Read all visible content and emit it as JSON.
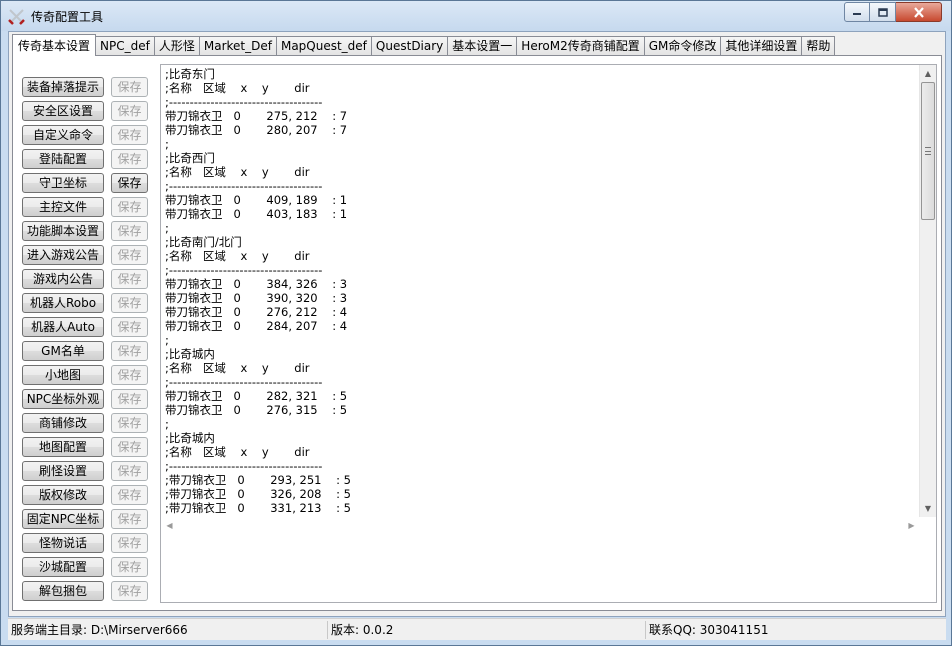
{
  "window": {
    "title": "传奇配置工具",
    "icon": "crossed-swords-icon",
    "min_icon": "minimize-icon",
    "max_icon": "maximize-icon",
    "close_icon": "close-icon"
  },
  "tabs": [
    {
      "label": "传奇基本设置",
      "active": true
    },
    {
      "label": "NPC_def"
    },
    {
      "label": "人形怪"
    },
    {
      "label": "Market_Def"
    },
    {
      "label": "MapQuest_def"
    },
    {
      "label": "QuestDiary"
    },
    {
      "label": "基本设置一"
    },
    {
      "label": "HeroM2传奇商铺配置"
    },
    {
      "label": "GM命令修改"
    },
    {
      "label": "其他详细设置"
    },
    {
      "label": "帮助"
    }
  ],
  "side_buttons": [
    {
      "label": "装备掉落提示",
      "save": "保存",
      "save_enabled": false
    },
    {
      "label": "安全区设置",
      "save": "保存",
      "save_enabled": false
    },
    {
      "label": "自定义命令",
      "save": "保存",
      "save_enabled": false
    },
    {
      "label": "登陆配置",
      "save": "保存",
      "save_enabled": false
    },
    {
      "label": "守卫坐标",
      "save": "保存",
      "save_enabled": true
    },
    {
      "label": "主控文件",
      "save": "保存",
      "save_enabled": false
    },
    {
      "label": "功能脚本设置",
      "save": "保存",
      "save_enabled": false
    },
    {
      "label": "进入游戏公告",
      "save": "保存",
      "save_enabled": false
    },
    {
      "label": "游戏内公告",
      "save": "保存",
      "save_enabled": false
    },
    {
      "label": "机器人Robo",
      "save": "保存",
      "save_enabled": false
    },
    {
      "label": "机器人Auto",
      "save": "保存",
      "save_enabled": false
    },
    {
      "label": "GM名单",
      "save": "保存",
      "save_enabled": false
    },
    {
      "label": "小地图",
      "save": "保存",
      "save_enabled": false
    },
    {
      "label": "NPC坐标外观",
      "save": "保存",
      "save_enabled": false
    },
    {
      "label": "商铺修改",
      "save": "保存",
      "save_enabled": false
    },
    {
      "label": "地图配置",
      "save": "保存",
      "save_enabled": false
    },
    {
      "label": "刷怪设置",
      "save": "保存",
      "save_enabled": false
    },
    {
      "label": "版权修改",
      "save": "保存",
      "save_enabled": false
    },
    {
      "label": "固定NPC坐标",
      "save": "保存",
      "save_enabled": false
    },
    {
      "label": "怪物说话",
      "save": "保存",
      "save_enabled": false
    },
    {
      "label": "沙城配置",
      "save": "保存",
      "save_enabled": false
    },
    {
      "label": "解包捆包",
      "save": "保存",
      "save_enabled": false
    }
  ],
  "editor": {
    "text": ";比奇东门\n;名称   区域    x    y       dir\n;-------------------------------------\n带刀锦衣卫   0       275, 212    : 7\n带刀锦衣卫   0       280, 207    : 7\n;\n;比奇西门\n;名称   区域    x    y       dir\n;-------------------------------------\n带刀锦衣卫   0       409, 189    : 1\n带刀锦衣卫   0       403, 183    : 1\n;\n;比奇南门/北门\n;名称   区域    x    y       dir\n;-------------------------------------\n带刀锦衣卫   0       384, 326    : 3\n带刀锦衣卫   0       390, 320    : 3\n带刀锦衣卫   0       276, 212    : 4\n带刀锦衣卫   0       284, 207    : 4\n;\n;比奇城内\n;名称   区域    x    y       dir\n;-------------------------------------\n带刀锦衣卫   0       282, 321    : 5\n带刀锦衣卫   0       276, 315    : 5\n;\n;比奇城内\n;名称   区域    x    y       dir\n;-------------------------------------\n;带刀锦衣卫   0       293, 251    : 5\n;带刀锦衣卫   0       326, 208    : 5\n;带刀锦衣卫   0       331, 213    : 5"
  },
  "status": {
    "root_dir": "服务端主目录: D:\\Mirserver666",
    "version": "版本: 0.0.2",
    "contact": "联系QQ: 303041151"
  }
}
